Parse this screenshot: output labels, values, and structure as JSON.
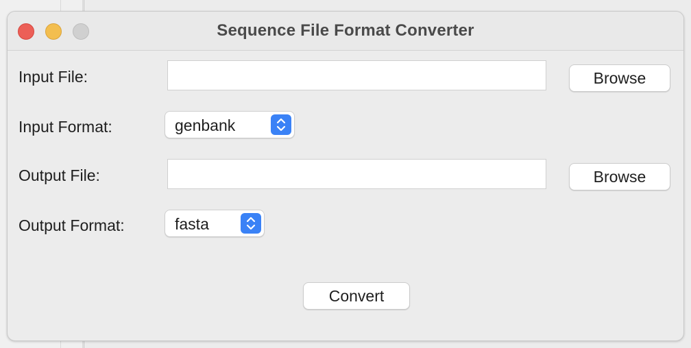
{
  "window": {
    "title": "Sequence File Format Converter"
  },
  "form": {
    "input_file": {
      "label": "Input File:",
      "value": "",
      "browse_label": "Browse"
    },
    "input_format": {
      "label": "Input Format:",
      "selected": "genbank"
    },
    "output_file": {
      "label": "Output File:",
      "value": "",
      "browse_label": "Browse"
    },
    "output_format": {
      "label": "Output Format:",
      "selected": "fasta"
    },
    "convert_label": "Convert"
  },
  "icons": {
    "close": "close-icon",
    "minimize": "minimize-icon",
    "zoom": "zoom-icon",
    "stepper": "chevron-up-down-icon"
  },
  "colors": {
    "close": "#ec5f57",
    "minimize": "#f3be4f",
    "zoom_disabled": "#d0d0d0",
    "accent": "#3a82f6",
    "window_bg": "#ececec"
  }
}
